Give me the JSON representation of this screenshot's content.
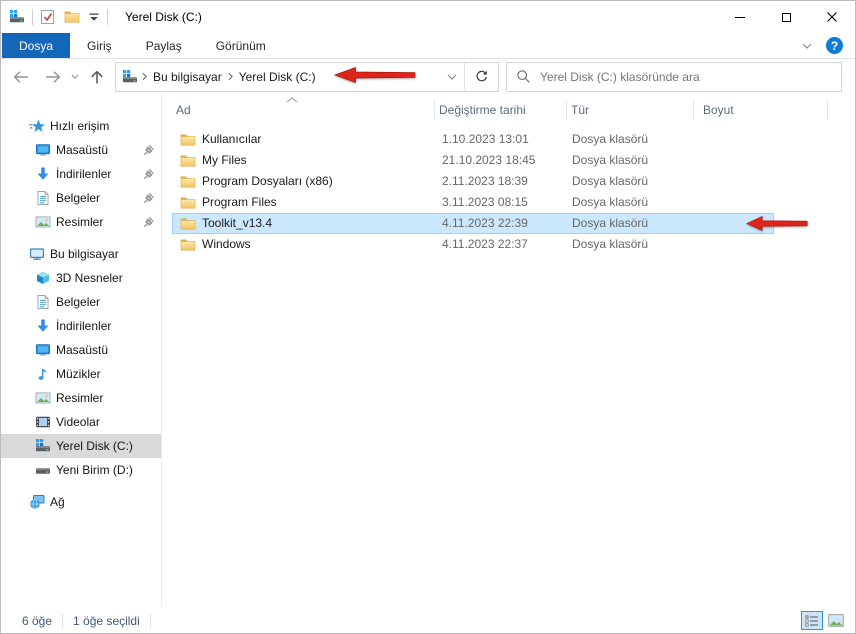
{
  "window": {
    "title": "Yerel Disk (C:)"
  },
  "ribbon": {
    "file_tab": "Dosya",
    "tabs": [
      "Giriş",
      "Paylaş",
      "Görünüm"
    ]
  },
  "navigation": {
    "breadcrumb": [
      "Bu bilgisayar",
      "Yerel Disk (C:)"
    ],
    "search_placeholder": "Yerel Disk (C:) klasöründe ara"
  },
  "columns": {
    "name": "Ad",
    "date": "Değiştirme tarihi",
    "type": "Tür",
    "size": "Boyut"
  },
  "files": [
    {
      "name": "Kullanıcılar",
      "date": "1.10.2023 13:01",
      "type": "Dosya klasörü",
      "size": "",
      "selected": false
    },
    {
      "name": "My Files",
      "date": "21.10.2023 18:45",
      "type": "Dosya klasörü",
      "size": "",
      "selected": false
    },
    {
      "name": "Program Dosyaları (x86)",
      "date": "2.11.2023 18:39",
      "type": "Dosya klasörü",
      "size": "",
      "selected": false
    },
    {
      "name": "Program Files",
      "date": "3.11.2023 08:15",
      "type": "Dosya klasörü",
      "size": "",
      "selected": false
    },
    {
      "name": "Toolkit_v13.4",
      "date": "4.11.2023 22:39",
      "type": "Dosya klasörü",
      "size": "",
      "selected": true
    },
    {
      "name": "Windows",
      "date": "4.11.2023 22:37",
      "type": "Dosya klasörü",
      "size": "",
      "selected": false
    }
  ],
  "sidebar": {
    "quick_access": {
      "label": "Hızlı erişim",
      "items": [
        "Masaüstü",
        "İndirilenler",
        "Belgeler",
        "Resimler"
      ]
    },
    "this_pc": {
      "label": "Bu bilgisayar",
      "items": [
        "3D Nesneler",
        "Belgeler",
        "İndirilenler",
        "Masaüstü",
        "Müzikler",
        "Resimler",
        "Videolar",
        "Yerel Disk (C:)",
        "Yeni Birim (D:)"
      ]
    },
    "network": {
      "label": "Ağ"
    }
  },
  "status": {
    "total": "6 öğe",
    "selected": "1 öğe seçildi"
  },
  "icons": {
    "help_glyph": "?"
  },
  "colors": {
    "accent_blue": "#1467b8",
    "selection_fill": "#cce8ff",
    "selection_border": "#99d1ff",
    "sidebar_selection": "#d9d9d9",
    "arrow_red": "#e0241b",
    "help_blue": "#0f7bd7",
    "folder_yellow": "#f2c462"
  }
}
